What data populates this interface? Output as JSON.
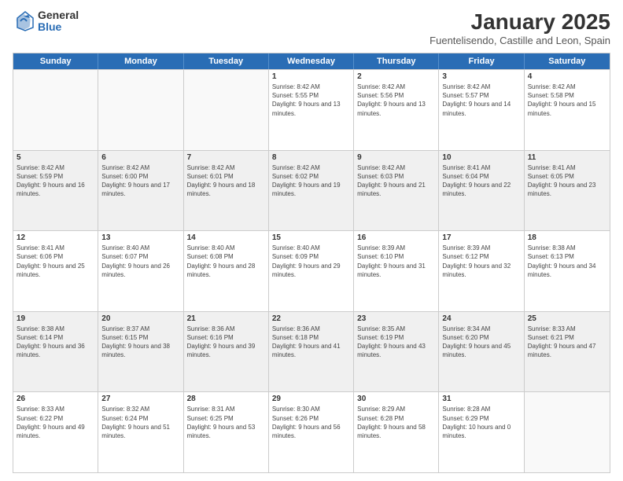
{
  "logo": {
    "general": "General",
    "blue": "Blue"
  },
  "title": "January 2025",
  "subtitle": "Fuentelisendo, Castille and Leon, Spain",
  "headers": [
    "Sunday",
    "Monday",
    "Tuesday",
    "Wednesday",
    "Thursday",
    "Friday",
    "Saturday"
  ],
  "rows": [
    [
      {
        "day": "",
        "info": "",
        "empty": true
      },
      {
        "day": "",
        "info": "",
        "empty": true
      },
      {
        "day": "",
        "info": "",
        "empty": true
      },
      {
        "day": "1",
        "info": "Sunrise: 8:42 AM\nSunset: 5:55 PM\nDaylight: 9 hours and 13 minutes."
      },
      {
        "day": "2",
        "info": "Sunrise: 8:42 AM\nSunset: 5:56 PM\nDaylight: 9 hours and 13 minutes."
      },
      {
        "day": "3",
        "info": "Sunrise: 8:42 AM\nSunset: 5:57 PM\nDaylight: 9 hours and 14 minutes."
      },
      {
        "day": "4",
        "info": "Sunrise: 8:42 AM\nSunset: 5:58 PM\nDaylight: 9 hours and 15 minutes."
      }
    ],
    [
      {
        "day": "5",
        "info": "Sunrise: 8:42 AM\nSunset: 5:59 PM\nDaylight: 9 hours and 16 minutes."
      },
      {
        "day": "6",
        "info": "Sunrise: 8:42 AM\nSunset: 6:00 PM\nDaylight: 9 hours and 17 minutes."
      },
      {
        "day": "7",
        "info": "Sunrise: 8:42 AM\nSunset: 6:01 PM\nDaylight: 9 hours and 18 minutes."
      },
      {
        "day": "8",
        "info": "Sunrise: 8:42 AM\nSunset: 6:02 PM\nDaylight: 9 hours and 19 minutes."
      },
      {
        "day": "9",
        "info": "Sunrise: 8:42 AM\nSunset: 6:03 PM\nDaylight: 9 hours and 21 minutes."
      },
      {
        "day": "10",
        "info": "Sunrise: 8:41 AM\nSunset: 6:04 PM\nDaylight: 9 hours and 22 minutes."
      },
      {
        "day": "11",
        "info": "Sunrise: 8:41 AM\nSunset: 6:05 PM\nDaylight: 9 hours and 23 minutes."
      }
    ],
    [
      {
        "day": "12",
        "info": "Sunrise: 8:41 AM\nSunset: 6:06 PM\nDaylight: 9 hours and 25 minutes."
      },
      {
        "day": "13",
        "info": "Sunrise: 8:40 AM\nSunset: 6:07 PM\nDaylight: 9 hours and 26 minutes."
      },
      {
        "day": "14",
        "info": "Sunrise: 8:40 AM\nSunset: 6:08 PM\nDaylight: 9 hours and 28 minutes."
      },
      {
        "day": "15",
        "info": "Sunrise: 8:40 AM\nSunset: 6:09 PM\nDaylight: 9 hours and 29 minutes."
      },
      {
        "day": "16",
        "info": "Sunrise: 8:39 AM\nSunset: 6:10 PM\nDaylight: 9 hours and 31 minutes."
      },
      {
        "day": "17",
        "info": "Sunrise: 8:39 AM\nSunset: 6:12 PM\nDaylight: 9 hours and 32 minutes."
      },
      {
        "day": "18",
        "info": "Sunrise: 8:38 AM\nSunset: 6:13 PM\nDaylight: 9 hours and 34 minutes."
      }
    ],
    [
      {
        "day": "19",
        "info": "Sunrise: 8:38 AM\nSunset: 6:14 PM\nDaylight: 9 hours and 36 minutes."
      },
      {
        "day": "20",
        "info": "Sunrise: 8:37 AM\nSunset: 6:15 PM\nDaylight: 9 hours and 38 minutes."
      },
      {
        "day": "21",
        "info": "Sunrise: 8:36 AM\nSunset: 6:16 PM\nDaylight: 9 hours and 39 minutes."
      },
      {
        "day": "22",
        "info": "Sunrise: 8:36 AM\nSunset: 6:18 PM\nDaylight: 9 hours and 41 minutes."
      },
      {
        "day": "23",
        "info": "Sunrise: 8:35 AM\nSunset: 6:19 PM\nDaylight: 9 hours and 43 minutes."
      },
      {
        "day": "24",
        "info": "Sunrise: 8:34 AM\nSunset: 6:20 PM\nDaylight: 9 hours and 45 minutes."
      },
      {
        "day": "25",
        "info": "Sunrise: 8:33 AM\nSunset: 6:21 PM\nDaylight: 9 hours and 47 minutes."
      }
    ],
    [
      {
        "day": "26",
        "info": "Sunrise: 8:33 AM\nSunset: 6:22 PM\nDaylight: 9 hours and 49 minutes."
      },
      {
        "day": "27",
        "info": "Sunrise: 8:32 AM\nSunset: 6:24 PM\nDaylight: 9 hours and 51 minutes."
      },
      {
        "day": "28",
        "info": "Sunrise: 8:31 AM\nSunset: 6:25 PM\nDaylight: 9 hours and 53 minutes."
      },
      {
        "day": "29",
        "info": "Sunrise: 8:30 AM\nSunset: 6:26 PM\nDaylight: 9 hours and 56 minutes."
      },
      {
        "day": "30",
        "info": "Sunrise: 8:29 AM\nSunset: 6:28 PM\nDaylight: 9 hours and 58 minutes."
      },
      {
        "day": "31",
        "info": "Sunrise: 8:28 AM\nSunset: 6:29 PM\nDaylight: 10 hours and 0 minutes."
      },
      {
        "day": "",
        "info": "",
        "empty": true
      }
    ]
  ]
}
